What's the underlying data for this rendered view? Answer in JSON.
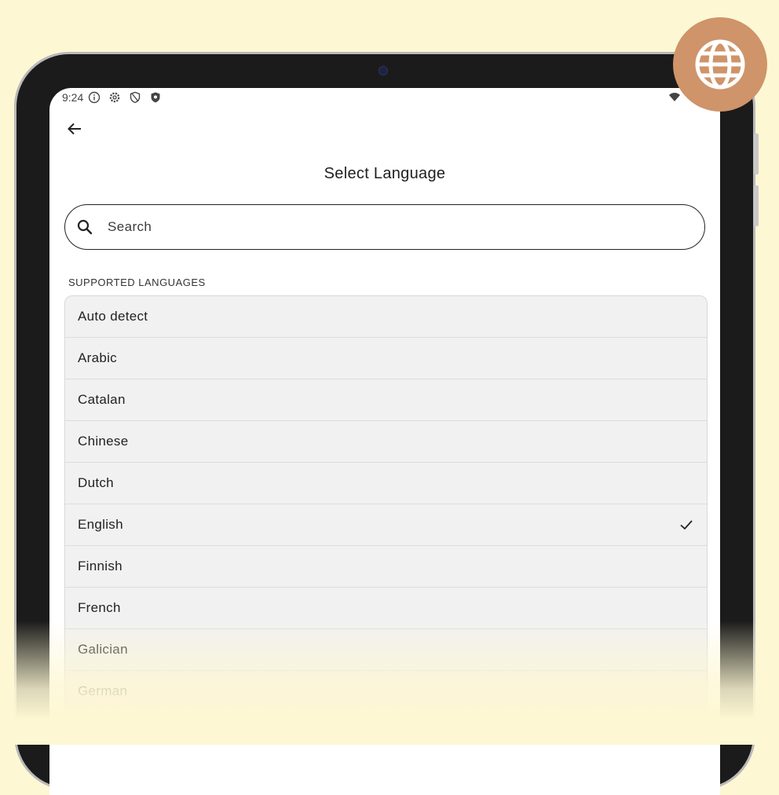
{
  "status_bar": {
    "time": "9:24"
  },
  "header": {
    "title": "Select Language"
  },
  "search": {
    "placeholder": "Search"
  },
  "section": {
    "label": "SUPPORTED LANGUAGES"
  },
  "languages": [
    {
      "label": "Auto detect",
      "selected": false
    },
    {
      "label": "Arabic",
      "selected": false
    },
    {
      "label": "Catalan",
      "selected": false
    },
    {
      "label": "Chinese",
      "selected": false
    },
    {
      "label": "Dutch",
      "selected": false
    },
    {
      "label": "English",
      "selected": true
    },
    {
      "label": "Finnish",
      "selected": false
    },
    {
      "label": "French",
      "selected": false
    },
    {
      "label": "Galician",
      "selected": false
    },
    {
      "label": "German",
      "selected": false
    }
  ],
  "colors": {
    "background": "#fdf7d3",
    "badge": "#cf9469",
    "list_bg": "#f1f1f1"
  },
  "icons": {
    "back": "arrow-left-icon",
    "search": "search-icon",
    "selected": "check-icon",
    "badge": "globe-icon"
  }
}
